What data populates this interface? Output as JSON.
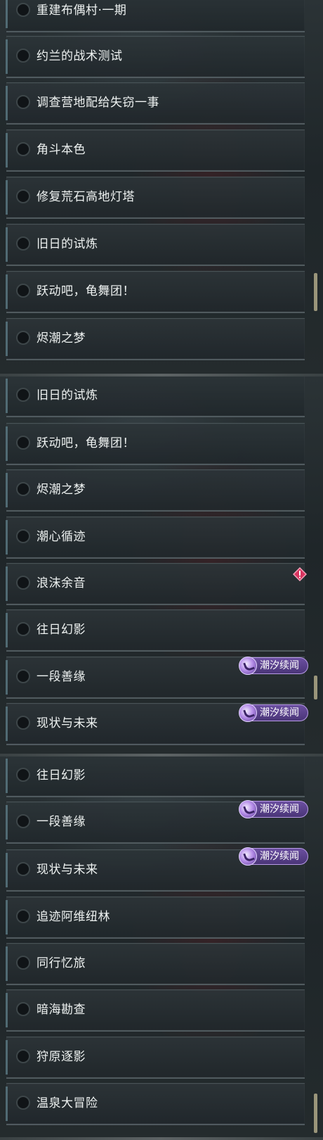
{
  "panels": [
    {
      "rows": [
        "重建布偶村·一期",
        "约兰的战术测试",
        "调查营地配给失窃一事",
        "角斗本色",
        "修复荒石高地灯塔",
        "旧日的试炼",
        "跃动吧，龟舞团！",
        "烬潮之梦"
      ]
    },
    {
      "rows": [
        "旧日的试炼",
        "跃动吧，龟舞团！",
        "烬潮之梦",
        "潮心循迹",
        "浪沫余音",
        "往日幻影",
        "一段善缘",
        "现状与未来"
      ]
    },
    {
      "rows": [
        "往日幻影",
        "一段善缘",
        "现状与未来",
        "追迹阿维纽林",
        "同行忆旅",
        "暗海勘查",
        "狩原逐影",
        "温泉大冒险"
      ]
    }
  ],
  "tag_label": "潮汐续闻",
  "colors": {
    "tag_bg": "#5a3f8c",
    "tag_border": "#b89be6",
    "alert": "#d8345f",
    "scrollbar": "#9a957a"
  },
  "icons": {
    "tag": "tide-tale-icon",
    "alert": "alert-diamond-icon",
    "checkbox": "checkbox-circle"
  }
}
